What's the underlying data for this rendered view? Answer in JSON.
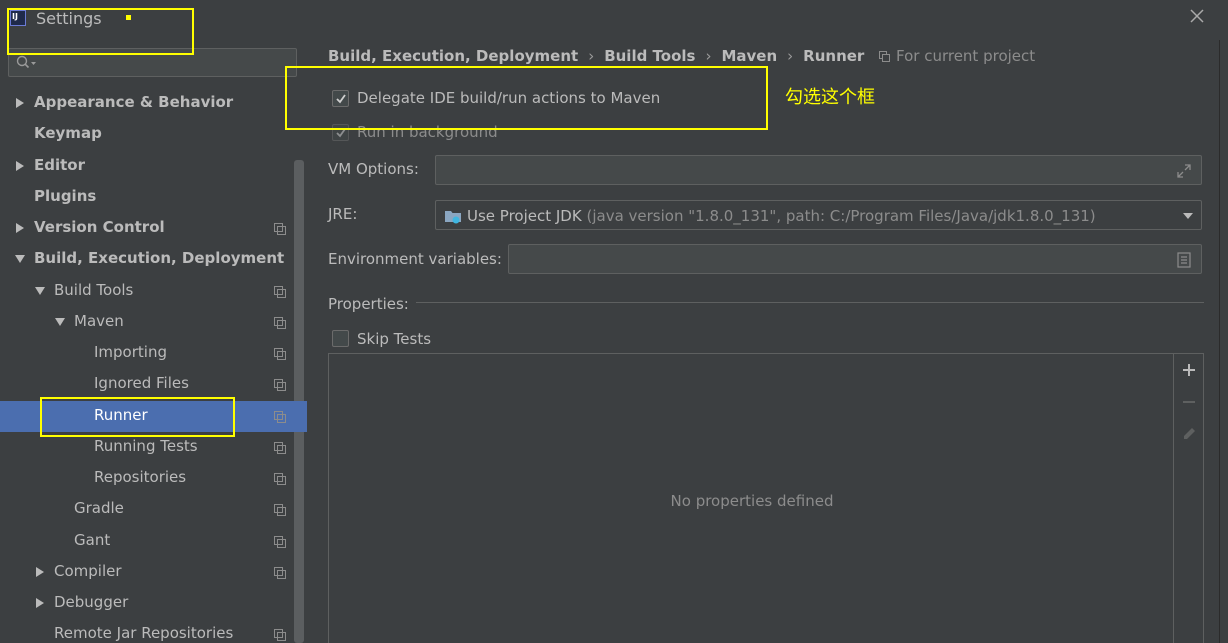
{
  "window": {
    "title": "Settings",
    "close_icon": "close-icon"
  },
  "sidebar": {
    "search": {
      "placeholder": "",
      "value": ""
    },
    "items": [
      {
        "label": "Appearance & Behavior",
        "bold": true,
        "expander": "collapsed"
      },
      {
        "label": "Keymap",
        "bold": true,
        "expander": "none"
      },
      {
        "label": "Editor",
        "bold": true,
        "expander": "collapsed"
      },
      {
        "label": "Plugins",
        "bold": true,
        "expander": "none"
      },
      {
        "label": "Version Control",
        "bold": true,
        "expander": "collapsed",
        "project_icon": true
      },
      {
        "label": "Build, Execution, Deployment",
        "bold": true,
        "expander": "expanded"
      },
      {
        "label": "Build Tools",
        "bold": false,
        "expander": "expanded",
        "project_icon": true
      },
      {
        "label": "Maven",
        "bold": false,
        "expander": "expanded",
        "project_icon": true
      },
      {
        "label": "Importing",
        "bold": false,
        "expander": "none",
        "project_icon": true
      },
      {
        "label": "Ignored Files",
        "bold": false,
        "expander": "none",
        "project_icon": true
      },
      {
        "label": "Runner",
        "bold": false,
        "expander": "none",
        "project_icon": true,
        "selected": true
      },
      {
        "label": "Running Tests",
        "bold": false,
        "expander": "none",
        "project_icon": true
      },
      {
        "label": "Repositories",
        "bold": false,
        "expander": "none",
        "project_icon": true
      },
      {
        "label": "Gradle",
        "bold": false,
        "expander": "none",
        "project_icon": true
      },
      {
        "label": "Gant",
        "bold": false,
        "expander": "none",
        "project_icon": true
      },
      {
        "label": "Compiler",
        "bold": false,
        "expander": "collapsed",
        "project_icon": true
      },
      {
        "label": "Debugger",
        "bold": false,
        "expander": "collapsed"
      },
      {
        "label": "Remote Jar Repositories",
        "bold": false,
        "expander": "none",
        "project_icon": true
      }
    ]
  },
  "breadcrumb": {
    "items": [
      "Build, Execution, Deployment",
      "Build Tools",
      "Maven",
      "Runner"
    ],
    "separator": "›",
    "scope_label": "For current project"
  },
  "options": {
    "delegate": {
      "label": "Delegate IDE build/run actions to Maven",
      "checked": true
    },
    "background": {
      "label": "Run in background",
      "checked": true,
      "disabled": true
    },
    "vm_options": {
      "label": "VM Options:",
      "value": ""
    },
    "jre": {
      "label": "JRE:",
      "selected": "Use Project JDK",
      "detail": "(java version \"1.8.0_131\", path: C:/Program Files/Java/jdk1.8.0_131)"
    },
    "env_vars": {
      "label": "Environment variables:",
      "value": ""
    },
    "properties": {
      "label": "Properties:"
    },
    "skip_tests": {
      "label": "Skip Tests",
      "checked": false
    },
    "table_empty": "No properties defined",
    "table_tools": [
      "add-icon",
      "remove-icon",
      "edit-icon"
    ]
  },
  "annotation": {
    "text": "勾选这个框",
    "color": "#ffff00"
  },
  "colors": {
    "background": "#3c3f41",
    "selection": "#4b6eaf",
    "text": "#bbbbbb",
    "muted": "#8c8c8c"
  }
}
